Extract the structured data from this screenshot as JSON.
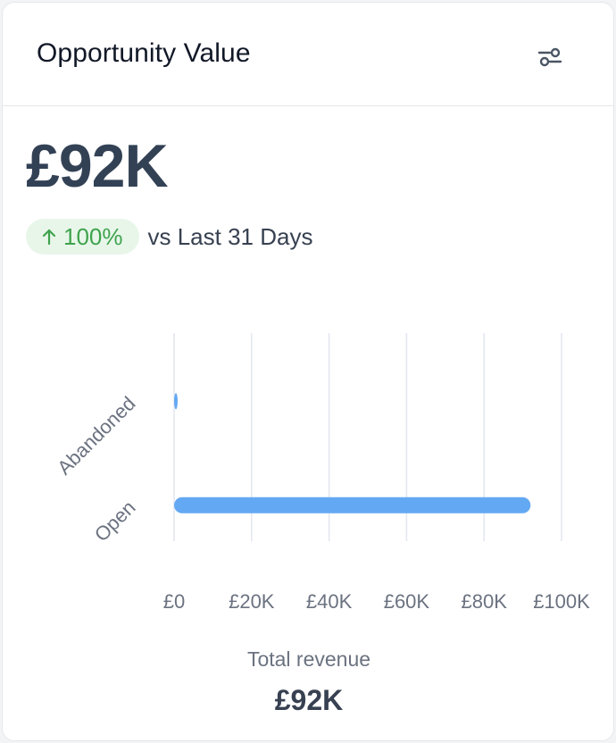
{
  "card": {
    "title": "Opportunity Value",
    "filter_icon": "filter-sliders-icon",
    "value": "£92K",
    "trend": {
      "direction_icon": "arrow-up-icon",
      "percent": "100%",
      "comparison": "vs Last 31 Days",
      "color": "#3fa34d",
      "background": "#e8f6ea"
    },
    "caption": "Total revenue",
    "total": "£92K"
  },
  "chart_data": {
    "type": "bar",
    "orientation": "horizontal",
    "categories": [
      "Abandoned",
      "Open"
    ],
    "values": [
      0,
      92000
    ],
    "xlim": [
      0,
      100000
    ],
    "x_ticks": [
      "£0",
      "£20K",
      "£40K",
      "£60K",
      "£80K",
      "£100K"
    ],
    "xlabel": "Total revenue",
    "grid": true,
    "bar_color": "#63a8f2"
  }
}
